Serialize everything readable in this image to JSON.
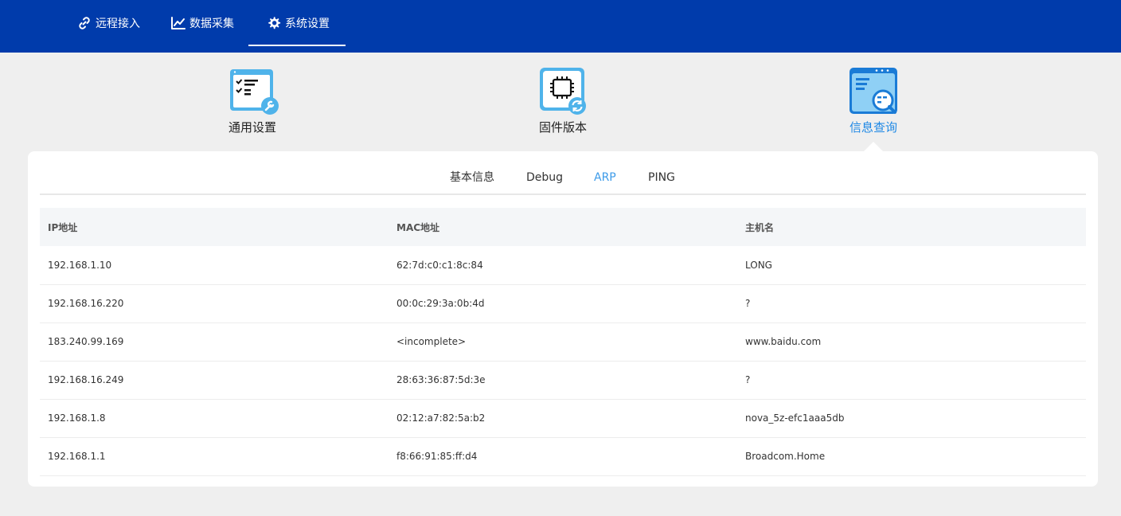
{
  "colors": {
    "topbar": "#003bab",
    "accent": "#3d9be9",
    "page_bg": "#efefef"
  },
  "nav": {
    "items": [
      {
        "label": "远程接入",
        "icon": "link-icon"
      },
      {
        "label": "数据采集",
        "icon": "chart-line-icon"
      },
      {
        "label": "系统设置",
        "icon": "gear-icon",
        "active": true
      }
    ]
  },
  "categories": [
    {
      "label": "通用设置",
      "icon": "checklist-wrench-icon"
    },
    {
      "label": "固件版本",
      "icon": "chip-refresh-icon"
    },
    {
      "label": "信息查询",
      "icon": "window-search-icon",
      "active": true
    }
  ],
  "subtabs": [
    {
      "label": "基本信息"
    },
    {
      "label": "Debug"
    },
    {
      "label": "ARP",
      "active": true
    },
    {
      "label": "PING"
    }
  ],
  "table": {
    "headers": [
      "IP地址",
      "MAC地址",
      "主机名"
    ],
    "rows": [
      [
        "192.168.1.10",
        "62:7d:c0:c1:8c:84",
        "LONG"
      ],
      [
        "192.168.16.220",
        "00:0c:29:3a:0b:4d",
        "?"
      ],
      [
        "183.240.99.169",
        "<incomplete>",
        "www.baidu.com"
      ],
      [
        "192.168.16.249",
        "28:63:36:87:5d:3e",
        "?"
      ],
      [
        "192.168.1.8",
        "02:12:a7:82:5a:b2",
        "nova_5z-efc1aaa5db"
      ],
      [
        "192.168.1.1",
        "f8:66:91:85:ff:d4",
        "Broadcom.Home"
      ]
    ]
  }
}
